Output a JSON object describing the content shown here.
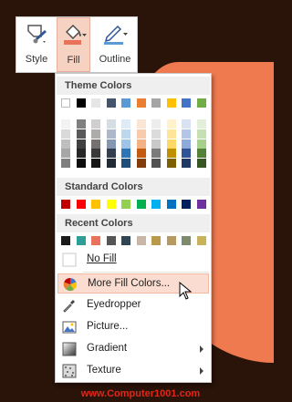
{
  "toolbar": {
    "style_label": "Style",
    "fill_label": "Fill",
    "outline_label": "Outline",
    "icons": [
      "style-icon",
      "fill-bucket-icon",
      "outline-pen-icon"
    ]
  },
  "menu": {
    "theme_header": "Theme Colors",
    "theme_colors": [
      "#ffffff",
      "#000000",
      "#e7e6e6",
      "#44546a",
      "#5b9bd5",
      "#ed7d31",
      "#a5a5a5",
      "#ffc000",
      "#4472c4",
      "#70ad47"
    ],
    "theme_shades": [
      [
        "#f2f2f2",
        "#d9d9d9",
        "#bfbfbf",
        "#a6a6a6",
        "#7f7f7f"
      ],
      [
        "#7f7f7f",
        "#595959",
        "#404040",
        "#262626",
        "#0d0d0d"
      ],
      [
        "#d0cece",
        "#aeabab",
        "#757171",
        "#3a3838",
        "#171616"
      ],
      [
        "#d6dce4",
        "#adb9ca",
        "#8497b0",
        "#333f4f",
        "#222a35"
      ],
      [
        "#deebf6",
        "#bdd7ee",
        "#9dc3e6",
        "#2e75b5",
        "#1f4e79"
      ],
      [
        "#fbe5d5",
        "#f7cbac",
        "#f4b183",
        "#c55a11",
        "#833c0b"
      ],
      [
        "#ededed",
        "#dbdbdb",
        "#c9c9c9",
        "#7b7b7b",
        "#525252"
      ],
      [
        "#fff2cc",
        "#fee599",
        "#ffd965",
        "#bf9000",
        "#7f6000"
      ],
      [
        "#d9e2f3",
        "#b4c6e7",
        "#8eaadb",
        "#2f5496",
        "#1f3864"
      ],
      [
        "#e2efd9",
        "#c5e0b3",
        "#a8d08d",
        "#538135",
        "#375623"
      ]
    ],
    "standard_header": "Standard Colors",
    "standard_colors": [
      "#c00000",
      "#ff0000",
      "#ffc000",
      "#ffff00",
      "#92d050",
      "#00b050",
      "#00b0f0",
      "#0070c0",
      "#002060",
      "#7030a0"
    ],
    "recent_header": "Recent Colors",
    "recent_colors": [
      "#1a1a1a",
      "#2e9e96",
      "#e9735a",
      "#555555",
      "#2f4652",
      "#c8b6a8",
      "#b89a4a",
      "#b79a62",
      "#7d8a6e",
      "#c9b35a"
    ],
    "items": [
      {
        "label": "No Fill",
        "icon": "no-fill-icon",
        "submenu": false
      },
      {
        "label": "More Fill Colors...",
        "icon": "color-wheel-icon",
        "submenu": false,
        "highlighted": true
      },
      {
        "label": "Eyedropper",
        "icon": "eyedropper-icon",
        "submenu": false
      },
      {
        "label": "Picture...",
        "icon": "picture-icon",
        "submenu": false
      },
      {
        "label": "Gradient",
        "icon": "gradient-icon",
        "submenu": true
      },
      {
        "label": "Texture",
        "icon": "texture-icon",
        "submenu": true
      }
    ]
  },
  "watermark": "www.Computer1001.com"
}
